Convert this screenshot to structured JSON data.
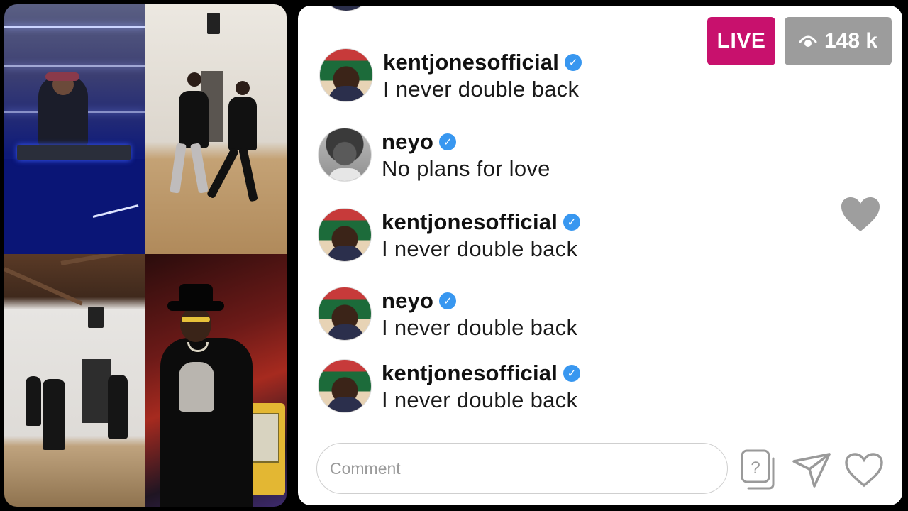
{
  "live_badge": "LIVE",
  "viewers": "148 k",
  "comment_placeholder": "Comment",
  "partial_comment": {
    "message": "I never double back"
  },
  "comments": [
    {
      "username": "kentjonesofficial",
      "message": "I never double back",
      "avatar": "kentjones-avatar",
      "verified": true
    },
    {
      "username": "neyo",
      "message": "No plans for love",
      "avatar": "neyo-avatar",
      "verified": true
    },
    {
      "username": "kentjonesofficial",
      "message": "I never double back",
      "avatar": "kentjones-avatar",
      "verified": true
    },
    {
      "username": "neyo",
      "message": "I never double back",
      "avatar": "kentjones-avatar",
      "verified": true
    },
    {
      "username": "kentjonesofficial",
      "message": "I never double back",
      "avatar": "kentjones-avatar",
      "verified": true
    }
  ],
  "icons": {
    "viewers": "eye-icon",
    "verified": "verified-check-icon",
    "floating": "heart-icon",
    "question": "question-box-icon",
    "share": "send-icon",
    "like": "heart-outline-icon"
  },
  "colors": {
    "live": "#c8116d",
    "viewer_badge": "#9c9c9c",
    "verified": "#3897f0",
    "panel": "#ffffff"
  }
}
